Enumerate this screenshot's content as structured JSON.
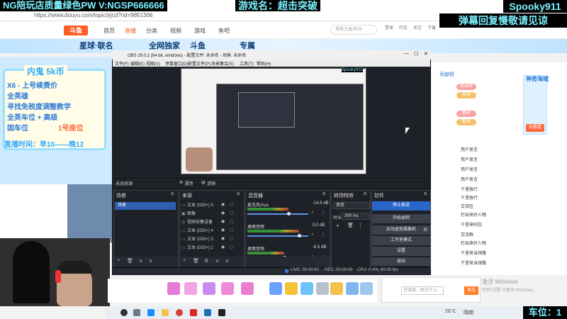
{
  "overlays": {
    "top_left": "NG陪玩店质量绿色PW V:NGSP666666",
    "top_center": "游戏名：超击突破",
    "top_right_name": "Spooky911",
    "top_right_note": "弹幕回复慢敬请见谅",
    "bottom_right": "车位：1"
  },
  "browser": {
    "url": "https://www.douyu.com/topic/jrjcd?rid=9851306",
    "nav": [
      "首页",
      "直播",
      "分类",
      "视频",
      "游戏",
      "鱼吧"
    ],
    "search_placeholder": "搜索主播/房间",
    "header_icons": [
      "登录",
      "历史",
      "关注",
      "下载",
      "开播"
    ],
    "banner_left": "星球·联名",
    "banner_mid": "全网独家",
    "banner_mid2": "斗鱼",
    "banner_right": "专属"
  },
  "pet_panel": {
    "title": "内鬼 5k币",
    "lines": [
      "X6 - 上号续费价",
      "全英雄",
      "寻找免税度调整教学",
      "全英车位 + 高级",
      "固车位",
      "1号座位"
    ],
    "time": "直播时间：早10——晚12"
  },
  "right_panel": {
    "tab": "贡献榜",
    "badges": [
      "粉丝牌",
      "粉丝",
      "粉丝",
      "粉丝"
    ],
    "rows": [
      "用户发言",
      "用户发言",
      "用户发言",
      "用户发言",
      "千里独行",
      "千里独行",
      "交流区",
      "打出来好人物",
      "千里来同志",
      "交流群",
      "打出来好人物",
      "千里来当领路",
      "千里来当领路"
    ],
    "card_title": "神奇海域",
    "card_button": "去看看"
  },
  "chat": {
    "placeholder": "发弹幕，聊点什么",
    "send": "发送",
    "activate_title": "激活 Windows",
    "activate_sub": "转到“设置”以激活 Windows。"
  },
  "taskbar": {
    "weather_temp": "26°C",
    "weather_desc": "晴朗"
  },
  "obs": {
    "title": "OBS 29.0.2 (64-bit, windows) - 配置文件: 未命名 - 场景: 未命名",
    "menu": [
      "文件(F)",
      "编辑(E)",
      "视图(V)",
      "停靠窗口(D)",
      "配置文件(P)",
      "场景集合(S)",
      "工具(T)",
      "帮助(H)"
    ],
    "preview_tag": "Spooky911",
    "scene_strip_label": "未选择源",
    "strip_props": "属性",
    "strip_filters": "滤镜",
    "docks": {
      "scenes": "场景",
      "sources": "来源",
      "mixer": "混音器",
      "transitions": "转场特效",
      "controls": "控件"
    },
    "scene_item": "场景",
    "sources": [
      {
        "icon": "▭",
        "name": "文本 (GDI+) 5"
      },
      {
        "icon": "▣",
        "name": "图像"
      },
      {
        "icon": "◎",
        "name": "视频采集设备"
      },
      {
        "icon": "▭",
        "name": "文本 (GDI+) 4"
      },
      {
        "icon": "▭",
        "name": "文本 (GDI+) 3"
      },
      {
        "icon": "▭",
        "name": "文本 (GDI+) 2"
      }
    ],
    "mixer": [
      {
        "name": "麦克风/Aux",
        "db": "-14.5 dB",
        "level": 0.68
      },
      {
        "name": "桌面音频",
        "db": "0.0 dB",
        "level": 0.85
      },
      {
        "name": "桌面音频",
        "db": "-6.5 dB",
        "level": 0.6
      }
    ],
    "transitions": {
      "type": "渐变",
      "duration_label": "时长",
      "duration": "300 ms"
    },
    "controls": [
      "停止推流",
      "开始录制",
      "启动虚拟摄像机",
      "工作室模式",
      "设置",
      "退出"
    ],
    "status": {
      "live": "LIVE: 00:00:00",
      "rec": "REC: 00:00:00",
      "cpu": "CPU: 0.4%, 60.00 fps"
    }
  }
}
